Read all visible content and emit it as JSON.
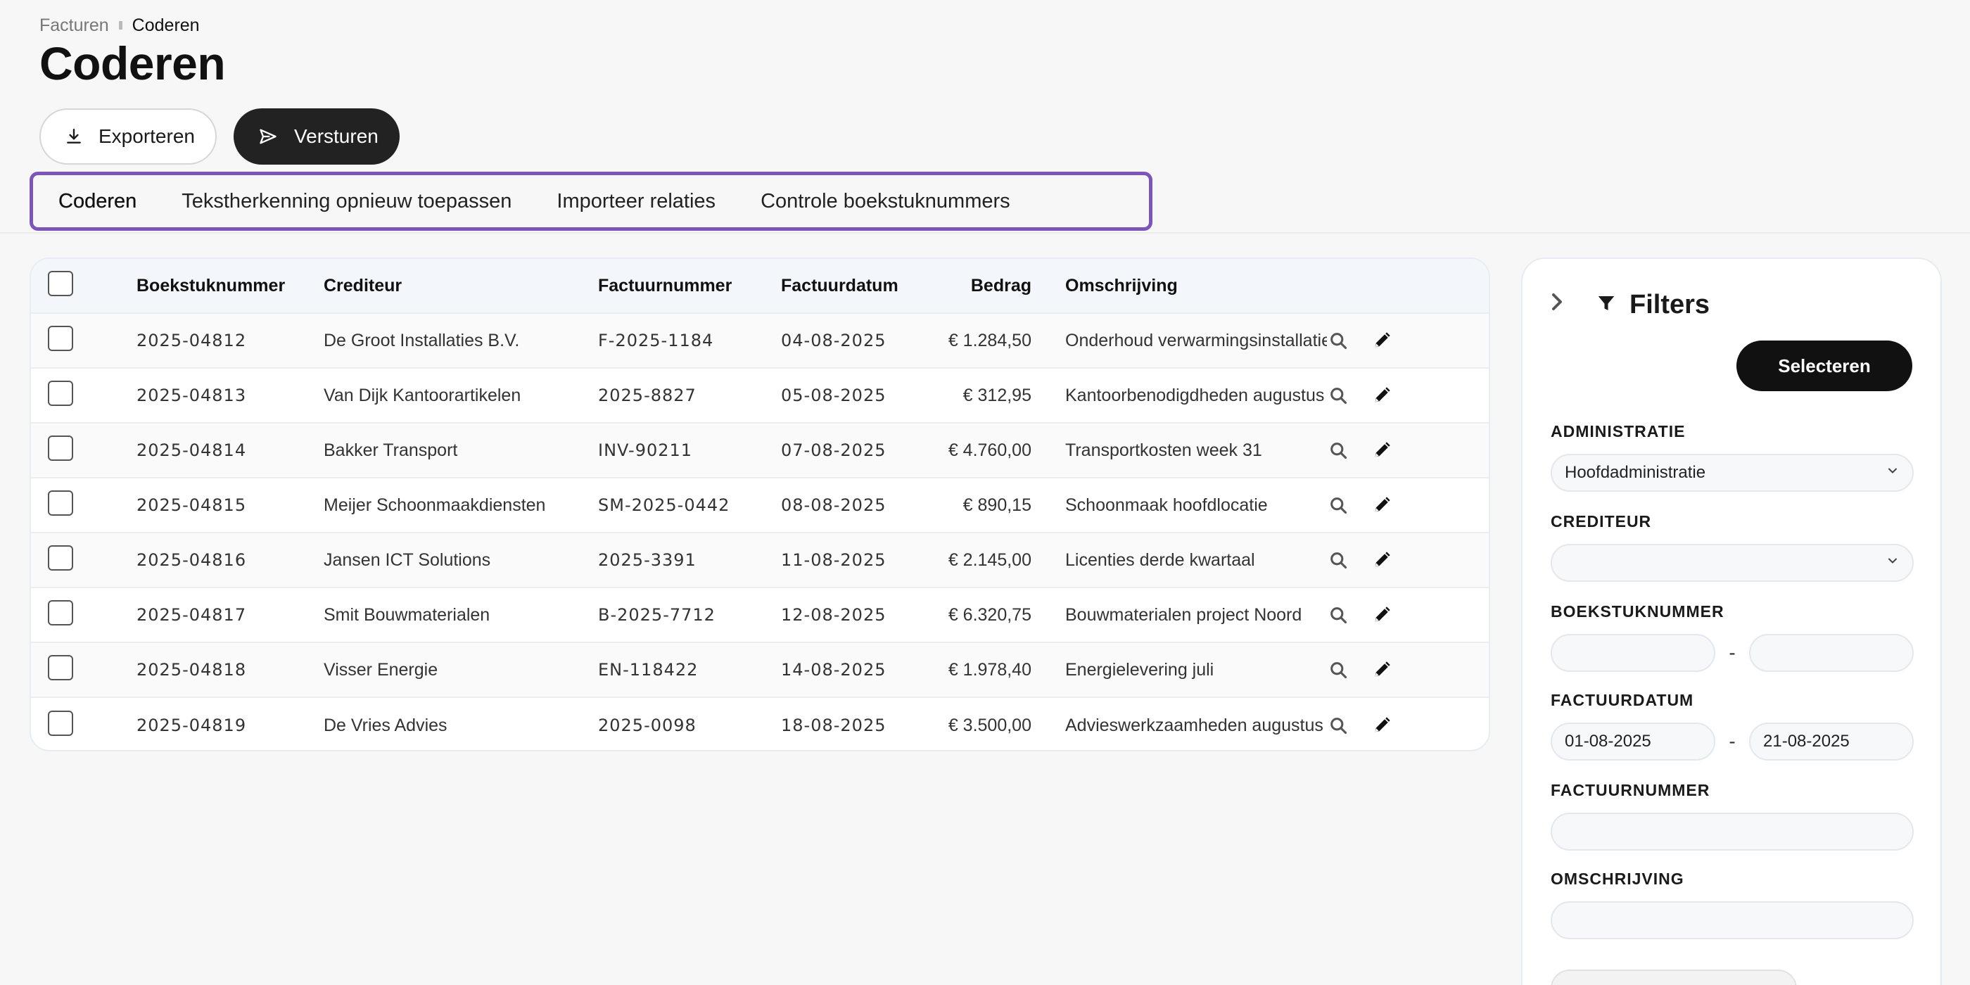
{
  "breadcrumb": {
    "parent": "Facturen",
    "current": "Coderen"
  },
  "page_title": "Coderen",
  "actions": {
    "export_label": "Exporteren",
    "send_label": "Versturen"
  },
  "tabs": [
    {
      "label": "Coderen",
      "active": true
    },
    {
      "label": "Tekstherkenning opnieuw toepassen",
      "active": false
    },
    {
      "label": "Importeer relaties",
      "active": false
    },
    {
      "label": "Controle boekstuknummers",
      "active": false
    }
  ],
  "accent_color": "#7b55b8",
  "table": {
    "headers": {
      "nr": "Boekstuknummer",
      "cred": "Crediteur",
      "fnr": "Factuurnummer",
      "date": "Factuurdatum",
      "amt": "Bedrag",
      "desc": "Omschrijving"
    },
    "rows": [
      {
        "nr": "2025-04812",
        "cred": "De Groot Installaties B.V.",
        "fnr": "F-2025-1184",
        "date": "04-08-2025",
        "amt": "€ 1.284,50",
        "desc": "Onderhoud verwarmingsinstallatie"
      },
      {
        "nr": "2025-04813",
        "cred": "Van Dijk Kantoorartikelen",
        "fnr": "2025-8827",
        "date": "05-08-2025",
        "amt": "€ 312,95",
        "desc": "Kantoorbenodigdheden augustus"
      },
      {
        "nr": "2025-04814",
        "cred": "Bakker Transport",
        "fnr": "INV-90211",
        "date": "07-08-2025",
        "amt": "€ 4.760,00",
        "desc": "Transportkosten week 31"
      },
      {
        "nr": "2025-04815",
        "cred": "Meijer Schoonmaakdiensten",
        "fnr": "SM-2025-0442",
        "date": "08-08-2025",
        "amt": "€ 890,15",
        "desc": "Schoonmaak hoofdlocatie"
      },
      {
        "nr": "2025-04816",
        "cred": "Jansen ICT Solutions",
        "fnr": "2025-3391",
        "date": "11-08-2025",
        "amt": "€ 2.145,00",
        "desc": "Licenties derde kwartaal"
      },
      {
        "nr": "2025-04817",
        "cred": "Smit Bouwmaterialen",
        "fnr": "B-2025-7712",
        "date": "12-08-2025",
        "amt": "€ 6.320,75",
        "desc": "Bouwmaterialen project Noord"
      },
      {
        "nr": "2025-04818",
        "cred": "Visser Energie",
        "fnr": "EN-118422",
        "date": "14-08-2025",
        "amt": "€ 1.978,40",
        "desc": "Energielevering juli"
      },
      {
        "nr": "2025-04819",
        "cred": "De Vries Advies",
        "fnr": "2025-0098",
        "date": "18-08-2025",
        "amt": "€ 3.500,00",
        "desc": "Advieswerkzaamheden augustus"
      }
    ],
    "row_icons": [
      "search-icon",
      "pencil-icon"
    ]
  },
  "filters": {
    "title": "Filters",
    "select_label": "Selecteren",
    "administratie": {
      "label": "ADMINISTRATIE",
      "value": "Hoofdadministratie"
    },
    "crediteur": {
      "label": "CREDITEUR",
      "value": ""
    },
    "boekstuknummer": {
      "label": "BOEKSTUKNUMMER",
      "from": "",
      "to": ""
    },
    "factuurdatum": {
      "label": "FACTUURDATUM",
      "from": "01-08-2025",
      "to": "21-08-2025"
    },
    "factuurnummer": {
      "label": "FACTUURNUMMER",
      "value": ""
    },
    "omschrijving": {
      "label": "OMSCHRIJVING",
      "value": ""
    },
    "range_separator": "-"
  }
}
